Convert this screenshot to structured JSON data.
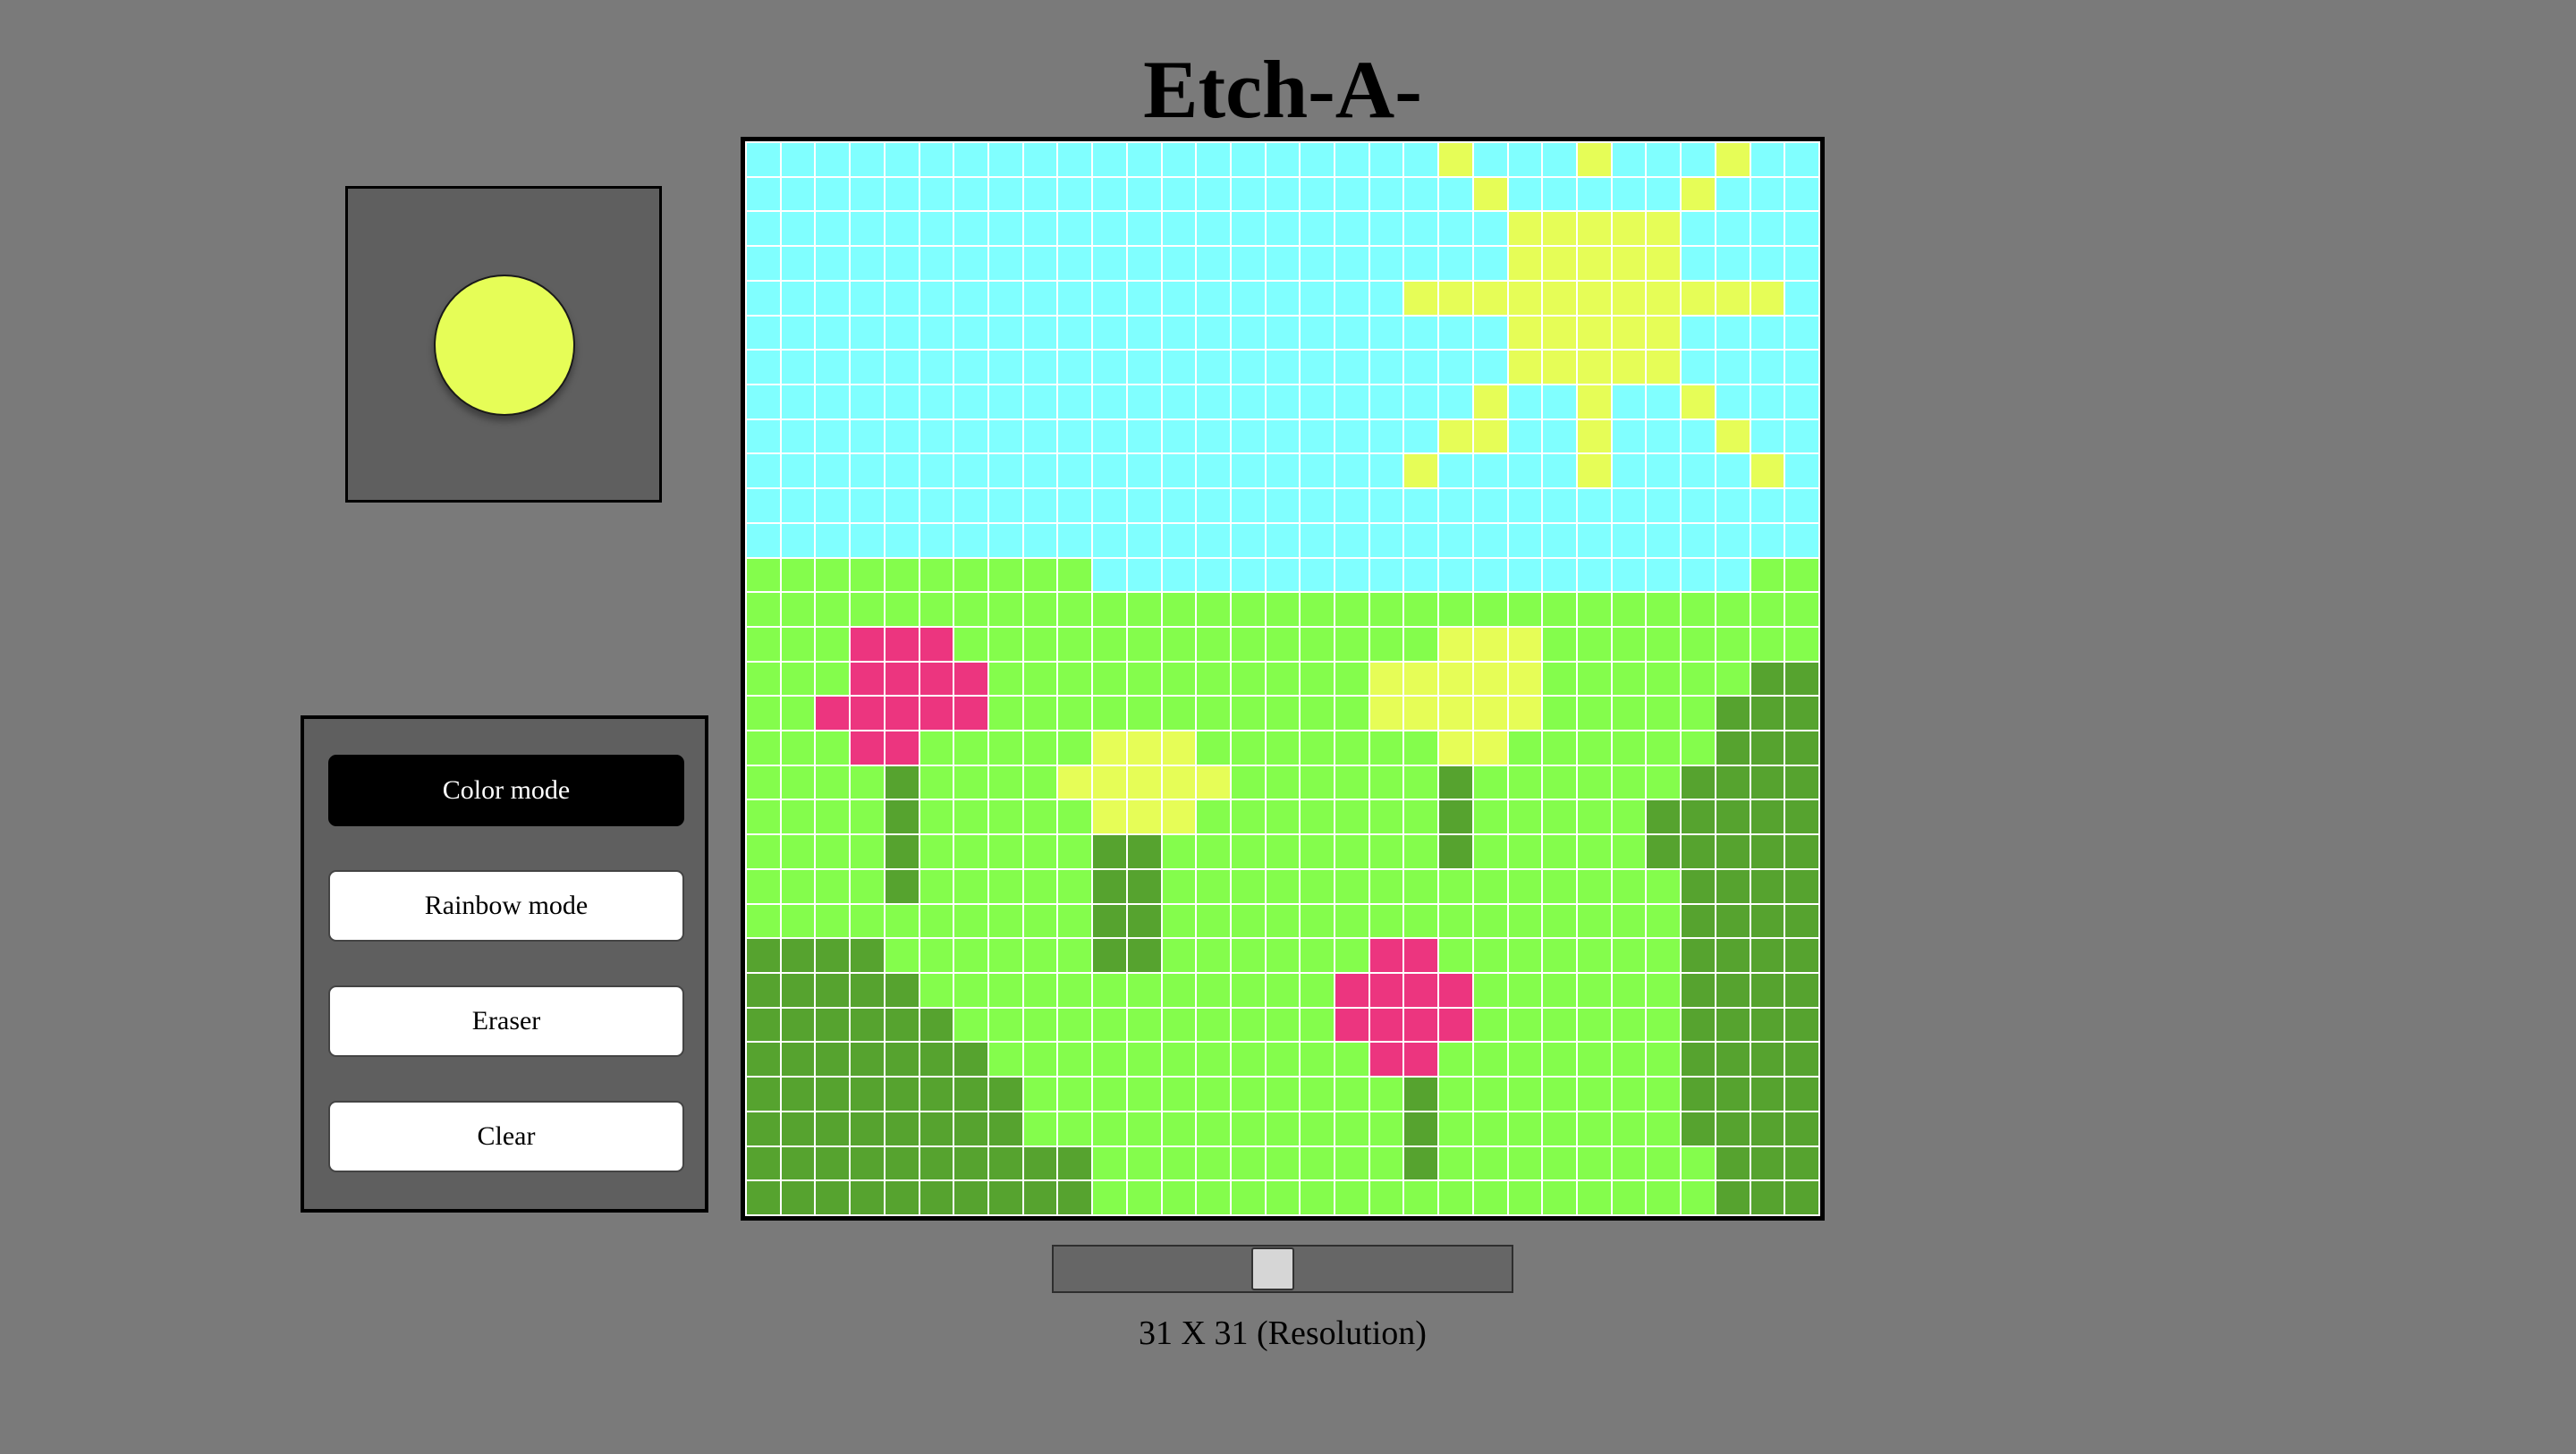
{
  "title": "Etch-A-Sketch",
  "current_color": "#e6fd57",
  "buttons": {
    "color_mode": "Color mode",
    "rainbow_mode": "Rainbow mode",
    "eraser": "Eraser",
    "clear": "Clear"
  },
  "active_mode": "color_mode",
  "slider": {
    "min": 1,
    "max": 64,
    "value": 31
  },
  "resolution_label": "31 X 31 (Resolution)",
  "palette": {
    "S": "#80ffff",
    "Y": "#e6fd57",
    "G": "#84fd4c",
    "D": "#56a32f",
    "P": "#ec357f"
  },
  "grid_rows": [
    "SSSSSSSSSSSSSSSSSSSSYSSSYSSSYSS",
    "SSSSSSSSSSSSSSSSSSSSSYSSSSSYSSS",
    "SSSSSSSSSSSSSSSSSSSSSSYYYYYSSSS",
    "SSSSSSSSSSSSSSSSSSSSSSYYYYYSSSS",
    "SSSSSSSSSSSSSSSSSSSYYYYYYYYYYYS",
    "SSSSSSSSSSSSSSSSSSSSSSYYYYYSSSS",
    "SSSSSSSSSSSSSSSSSSSSSSYYYYYSSSS",
    "SSSSSSSSSSSSSSSSSSSSSYSSYSSYSSS",
    "SSSSSSSSSSSSSSSSSSSSYYSSYSSSYSS",
    "SSSSSSSSSSSSSSSSSSSYSSSSYSSSSYS",
    "SSSSSSSSSSSSSSSSSSSSSSSSSSSSSSS",
    "SSSSSSSSSSSSSSSSSSSSSSSSSSSSSSS",
    "GGGGGGGGGGSSSSSSSSSSSSSSSSSSSGG",
    "GGGGGGGGGGGGGGGGGGGGGGGGGGGGGGG",
    "GGGPPPGGGGGGGGGGGGGGYYYGGGGGGGG",
    "GGGPPPPGGGGGGGGGGGYYYYYGGGGGGDD",
    "GGPPPPPGGGGGGGGGGGYYYYYGGGGGDDD",
    "GGGPPGGGGGYYYGGGGGGGYYGGGGGGDDD",
    "GGGGDGGGGYYYYYGGGGGGDGGGGGGDDDD",
    "GGGGDGGGGGYYYGGGGGGGDGGGGGDDDDD",
    "GGGGDGGGGGDDGGGGGGGGDGGGGGDDDDD",
    "GGGGDGGGGGDDGGGGGGGGGGGGGGGDDDD",
    "GGGGGGGGGGDDGGGGGGGGGGGGGGGDDDD",
    "DDDDGGGGGGDDGGGGGGPPGGGGGGGDDDD",
    "DDDDDGGGGGGGGGGGGPPPPGGGGGGDDDD",
    "DDDDDDGGGGGGGGGGGPPPPGGGGGGDDDD",
    "DDDDDDDGGGGGGGGGGGPPGGGGGGGDDDD",
    "DDDDDDDDGGGGGGGGGGGDGGGGGGGDDDD",
    "DDDDDDDDGGGGGGGGGGGDGGGGGGGDDDD",
    "DDDDDDDDDDGGGGGGGGGDGGGGGGGGDDD",
    "DDDDDDDDDDGGGGGGGGGGGGGGGGGGDDD"
  ]
}
